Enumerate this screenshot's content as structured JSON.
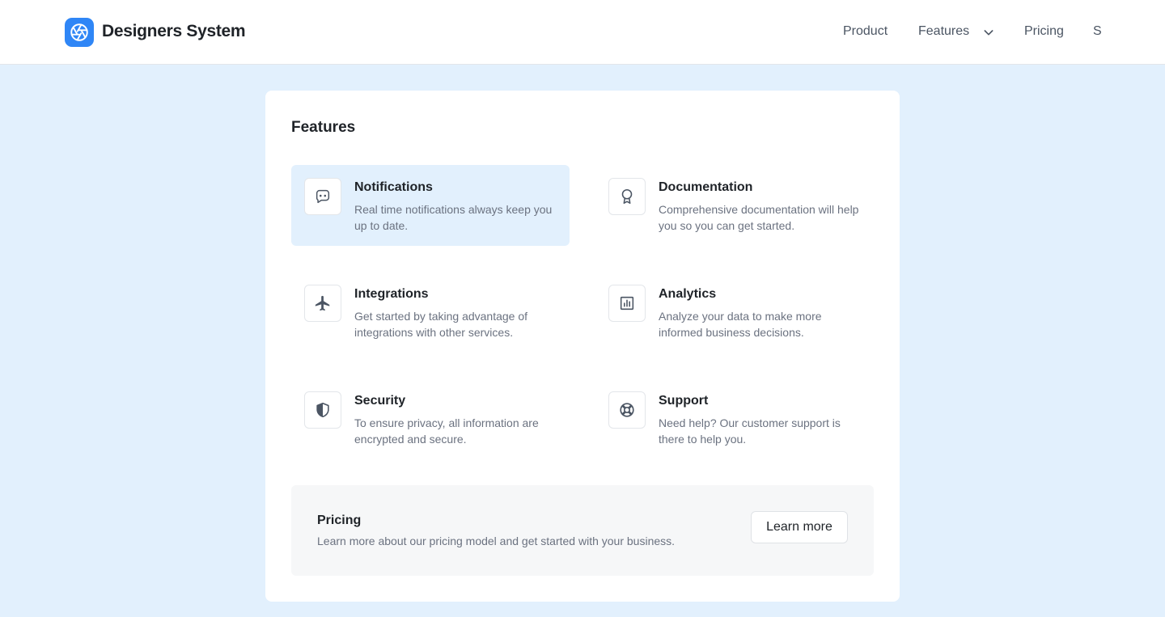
{
  "header": {
    "brand": "Designers System",
    "logo_icon": "aperture-icon",
    "nav": {
      "product": "Product",
      "features": "Features",
      "pricing": "Pricing",
      "cutoff": "S"
    }
  },
  "panel": {
    "title": "Features",
    "features": [
      {
        "title": "Notifications",
        "desc": "Real time notifications always keep you up to date.",
        "icon": "message-icon"
      },
      {
        "title": "Documentation",
        "desc": "Comprehensive documentation will help you so you can get started.",
        "icon": "award-icon"
      },
      {
        "title": "Integrations",
        "desc": "Get started by taking advantage of integrations with other services.",
        "icon": "airplane-icon"
      },
      {
        "title": "Analytics",
        "desc": "Analyze your data to make more informed business decisions.",
        "icon": "bar-chart-icon"
      },
      {
        "title": "Security",
        "desc": "To ensure privacy, all information are encrypted and secure.",
        "icon": "shield-icon"
      },
      {
        "title": "Support",
        "desc": "Need help? Our customer support is there to help you.",
        "icon": "lifebuoy-icon"
      }
    ],
    "pricing": {
      "title": "Pricing",
      "desc": "Learn more about our pricing model and get started with your business.",
      "button": "Learn more"
    }
  },
  "colors": {
    "background": "#e2f0fd",
    "accent": "#2f86f6",
    "active_item": "#e2f0fd"
  }
}
